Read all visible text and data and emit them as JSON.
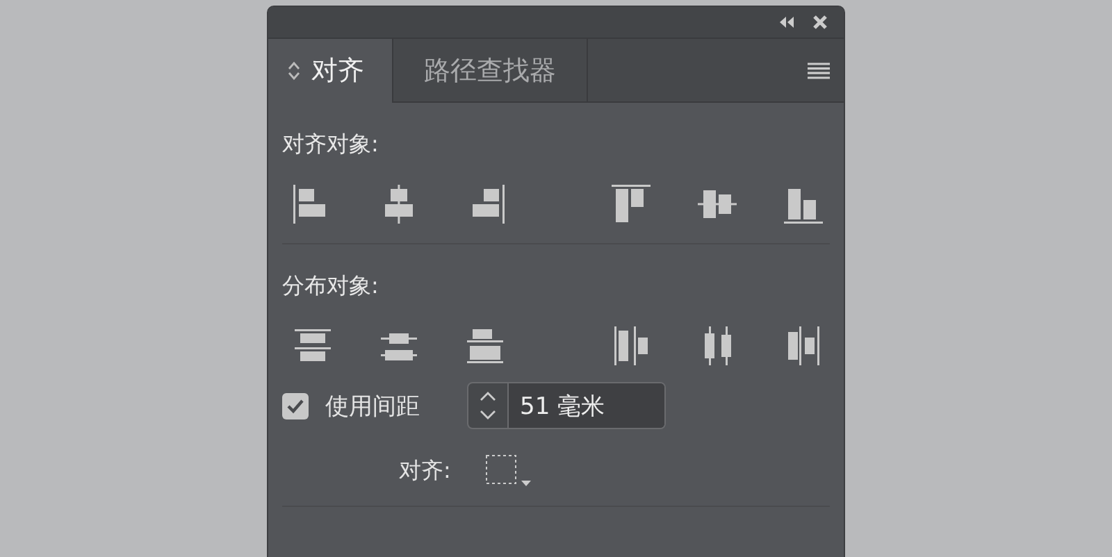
{
  "tabs": [
    {
      "label": "对齐",
      "selected": true
    },
    {
      "label": "路径查找器",
      "selected": false
    }
  ],
  "align_objects": {
    "label": "对齐对象:",
    "icons": [
      {
        "kind": "align-left"
      },
      {
        "kind": "align-hcenter"
      },
      {
        "kind": "align-right"
      },
      {
        "kind": "align-top"
      },
      {
        "kind": "align-vcenter"
      },
      {
        "kind": "align-bottom"
      }
    ]
  },
  "distribute_objects": {
    "label": "分布对象:",
    "icons": [
      {
        "kind": "dist-top"
      },
      {
        "kind": "dist-vcenter"
      },
      {
        "kind": "dist-bottom"
      },
      {
        "kind": "dist-left"
      },
      {
        "kind": "dist-hcenter"
      },
      {
        "kind": "dist-right"
      }
    ]
  },
  "spacing": {
    "label": "使用间距",
    "checked": true,
    "value": "51 毫米"
  },
  "align_to": {
    "label": "对齐:"
  }
}
